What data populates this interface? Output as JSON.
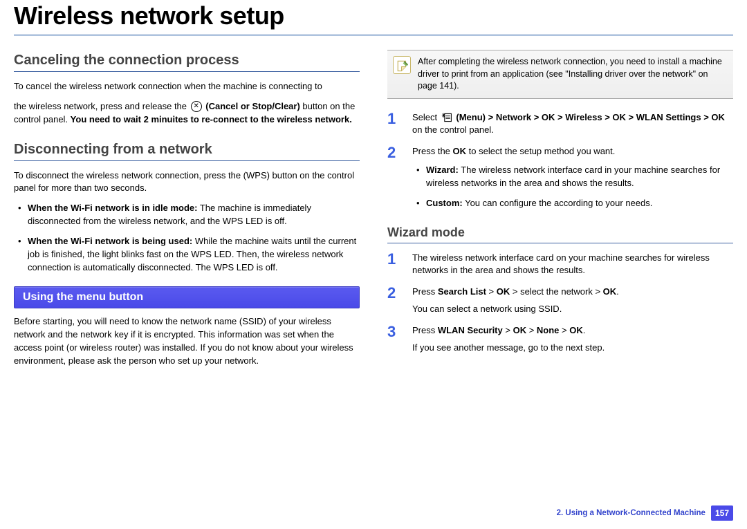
{
  "title": "Wireless network setup",
  "left": {
    "h2a": "Canceling the connection process",
    "p1a": "To cancel the wireless network connection when the machine is connecting to",
    "p1b_pre": "the wireless network, press and release the ",
    "p1b_btn": "(Cancel or Stop/Clear)",
    "p1b_post": " button on the control panel. ",
    "p1b_bold": "You need to wait 2 minuites to re-connect to the wireless network.",
    "h2b": "Disconnecting from a network",
    "p2": "To disconnect the wireless network connection, press the        (WPS) button on the control panel for more than two seconds.",
    "b1_bold": "When the Wi-Fi network is in idle mode:",
    "b1_rest": " The machine is immediately disconnected from the wireless network, and the WPS LED is off.",
    "b2_bold": "When the Wi-Fi network is being used:",
    "b2_rest": " While the machine waits until the current job is finished, the light blinks fast on the WPS LED. Then, the wireless network connection is automatically disconnected. The WPS LED is off.",
    "box": "Using the menu button",
    "p3": "Before starting, you will need to know the network name (SSID) of your wireless network and the network key if it is encrypted. This information was set when the access point (or wireless router) was installed. If you do not know about your wireless environment, please ask the person who set up your network."
  },
  "right": {
    "note": "After completing the wireless network connection, you need to install a machine driver to print from an application (see \"Installing driver over the network\" on page 141).",
    "step1_pre": "Select ",
    "step1_menuLabel": "(Menu)",
    "step1_path": " > Network > OK > Wireless > OK > WLAN Settings > OK",
    "step1_post": " on the control panel.",
    "step2_pre": "Press the ",
    "step2_ok": "OK",
    "step2_post": " to select the setup method you want.",
    "step2_b1_bold": "Wizard:",
    "step2_b1_rest": " The wireless network interface card in your machine searches for wireless networks in the area and shows the results.",
    "step2_b2_bold": "Custom:",
    "step2_b2_rest": " You can configure the according to your needs.",
    "h3": "Wizard mode",
    "wiz1": "The wireless network interface card on your machine searches for wireless networks in the area and shows the results.",
    "wiz2_pre": "Press ",
    "wiz2_bold1": "Search List",
    "wiz2_mid1": " > ",
    "wiz2_bold2": "OK",
    "wiz2_mid2": " > select the network > ",
    "wiz2_bold3": "OK",
    "wiz2_end": ".",
    "wiz2_sub": "You can select a network using SSID.",
    "wiz3_pre": "Press ",
    "wiz3_bold1": "WLAN Security",
    "wiz3_m1": " > ",
    "wiz3_bold2": "OK",
    "wiz3_m2": " > ",
    "wiz3_bold3": "None",
    "wiz3_m3": " > ",
    "wiz3_bold4": "OK",
    "wiz3_end": ".",
    "wiz3_sub": "If you see another message, go to the next step."
  },
  "footer": {
    "chapter": "2.  Using a Network-Connected Machine",
    "page": "157"
  }
}
